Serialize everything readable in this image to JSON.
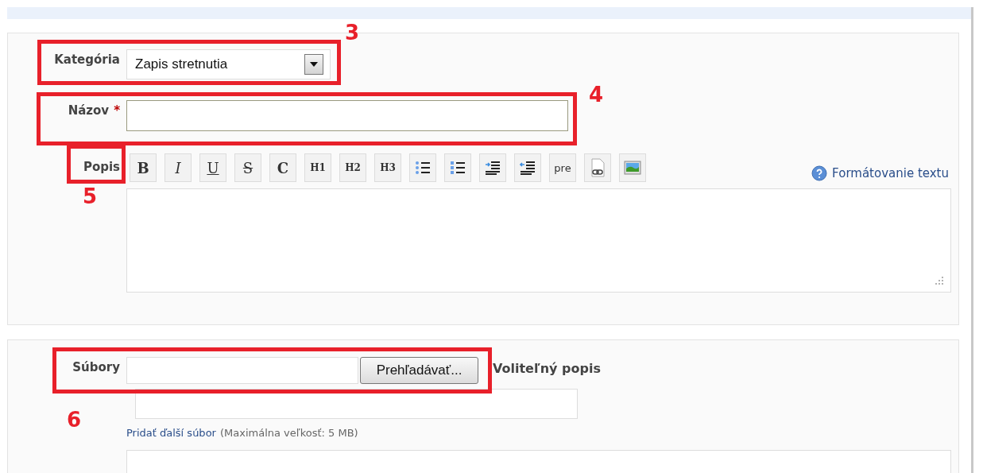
{
  "form": {
    "category": {
      "label": "Kategória",
      "value": "Zapis stretnutia"
    },
    "title": {
      "label": "Názov",
      "required_mark": "*"
    },
    "description": {
      "label": "Popis",
      "help_link": "Formátovanie textu",
      "toolbar": [
        {
          "kind": "text",
          "label": "B"
        },
        {
          "kind": "text",
          "label": "I"
        },
        {
          "kind": "text",
          "label": "U"
        },
        {
          "kind": "text",
          "label": "S"
        },
        {
          "kind": "text",
          "label": "C"
        },
        {
          "kind": "text",
          "label": "H1"
        },
        {
          "kind": "text",
          "label": "H2"
        },
        {
          "kind": "text",
          "label": "H3"
        },
        {
          "kind": "icon"
        },
        {
          "kind": "icon"
        },
        {
          "kind": "icon"
        },
        {
          "kind": "icon"
        },
        {
          "kind": "text",
          "label": "pre"
        },
        {
          "kind": "icon"
        },
        {
          "kind": "icon"
        }
      ]
    }
  },
  "files": {
    "label": "Súbory",
    "browse_button": "Prehľadávať...",
    "optional_description_label": "Voliteľný popis",
    "add_link": "Pridať ďalší súbor",
    "size_note": "(Maximálna veľkosť: 5 MB)"
  },
  "annotations": [
    {
      "number": "3"
    },
    {
      "number": "4"
    },
    {
      "number": "5"
    },
    {
      "number": "6"
    }
  ]
}
